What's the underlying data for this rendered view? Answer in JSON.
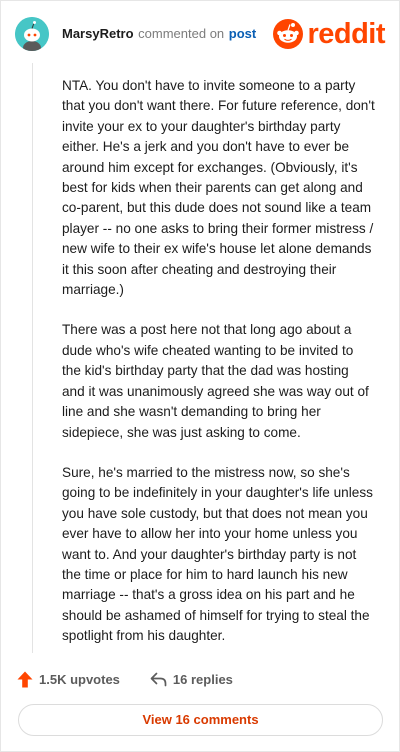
{
  "header": {
    "username": "MarsyRetro",
    "verb": "commented on",
    "post_link": "post",
    "logo_text": "reddit"
  },
  "comment": {
    "paragraphs": [
      "NTA. You don't have to invite someone to a party that you don't want there. For future reference, don't invite your ex to your daughter's birthday party either. He's a jerk and you don't have to ever be around him except for exchanges. (Obviously, it's best for kids when their parents can get along and co-parent, but this dude does not sound like a team player -- no one asks to bring their former mistress / new wife to their ex wife's house let alone demands it this soon after cheating and destroying their marriage.)",
      "There was a post here not that long ago about a dude who's wife cheated wanting to be invited to the kid's birthday party that the dad was hosting and it was unanimously agreed she was way out of line and she wasn't demanding to bring her sidepiece, she was just asking to come.",
      "Sure, he's married to the mistress now, so she's going to be indefinitely in your daughter's life unless you have sole custody, but that does not mean you ever have to allow her into your home unless you want to. And your daughter's birthday party is not the time or place for him to hard launch his new marriage -- that's a gross idea on his part and he should be ashamed of himself for trying to steal the spotlight from his daughter."
    ]
  },
  "actions": {
    "upvotes": "1.5K upvotes",
    "replies": "16 replies"
  },
  "view_comments": "View 16 comments",
  "colors": {
    "brand": "#ff4500",
    "upvote": "#ff4500",
    "link": "#0a5fb4",
    "avatar": "#46c6c6"
  },
  "icons": {
    "avatar": "snoo-avatar-icon",
    "logo": "reddit-snoo-icon",
    "upvote": "upvote-arrow-icon",
    "reply": "reply-arrow-icon"
  }
}
